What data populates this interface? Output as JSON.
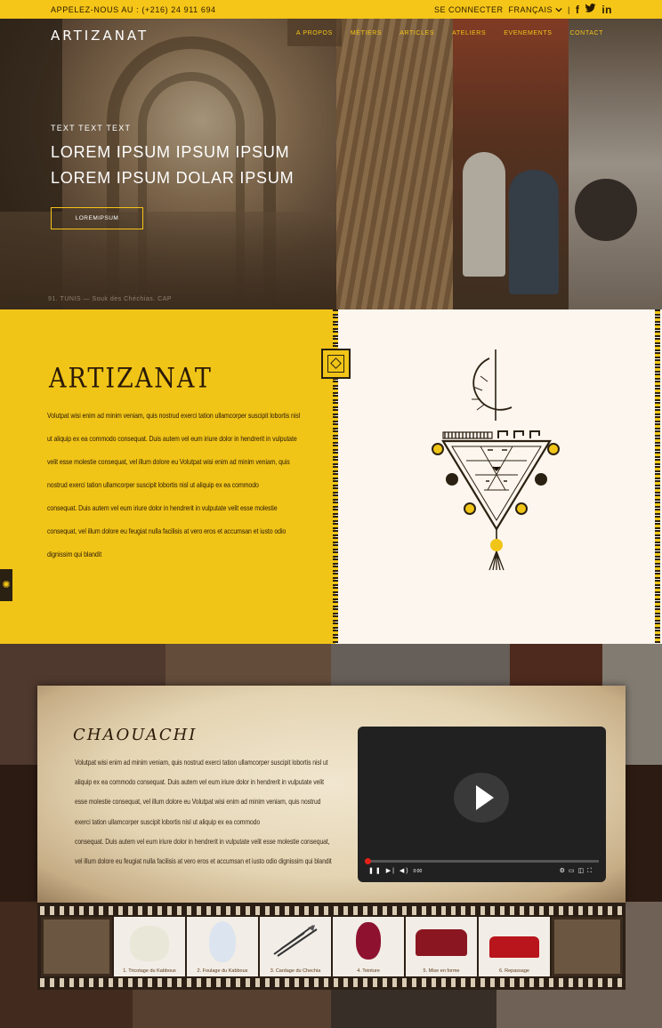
{
  "topbar": {
    "phone": "APPELEZ-NOUS AU : (+216) 24 911 694",
    "login": "SE CONNECTER",
    "language": "FRANÇAIS",
    "separator": "|",
    "social": [
      "facebook-icon",
      "twitter-icon",
      "linkedin-icon"
    ],
    "social_glyphs": {
      "facebook": "f",
      "twitter": "🐦",
      "linkedin": "in"
    }
  },
  "brand": {
    "logo_text": "ARTIZANAT"
  },
  "nav": {
    "items": [
      "A PROPOS",
      "MÉTIERS",
      "ARTICLES",
      "ATELIERS",
      "EVENEMENTS",
      "CONTACT"
    ],
    "active_index": 0
  },
  "hero": {
    "eyebrow": "TEXT TEXT TEXT",
    "headline_line1": "LOREM IPSUM IPSUM IPSUM",
    "headline_line2": "LOREM IPSUM DOLAR IPSUM",
    "button": "LOREMIPSUM",
    "photo_caption": "91. TUNIS — Souk des Chéchias. CAP"
  },
  "artizanat": {
    "title": "ARTIZANAT",
    "paragraph1": "Volutpat wisi enim ad minim veniam, quis nostrud exerci tation ullamcorper suscipit lobortis nisl ut aliquip ex ea commodo consequat. Duis autem vel eum iriure dolor in hendrerit in vulputate velit esse molestie consequat, vel illum dolore eu Volutpat wisi enim ad minim veniam, quis nostrud exerci tation ullamcorper suscipit lobortis nisl ut aliquip ex ea commodo",
    "paragraph2": "consequat. Duis autem vel eum iriure dolor in hendrerit in vulputate velit esse molestie consequat, vel illum dolore eu feugiat nulla facilisis at vero eros et accumsan et iusto odio dignissim qui blandit"
  },
  "chouachi": {
    "title": "CHAOUACHI",
    "paragraph1": "Volutpat wisi enim ad minim veniam, quis nostrud exerci tation ullamcorper suscipit lobortis nisl ut aliquip ex ea commodo consequat. Duis autem vel eum iriure dolor in hendrerit in vulputate velit esse molestie consequat, vel illum dolore eu Volutpat wisi enim ad minim veniam, quis nostrud exerci tation ullamcorper suscipit lobortis nisl ut aliquip ex ea commodo",
    "paragraph2": "consequat. Duis autem vel eum iriure dolor in hendrerit in vulputate velit esse molestie consequat, vel illum dolore eu feugiat nulla facilisis at vero eros et accumsan et iusto odio dignissim qui blandit",
    "video": {
      "time": "0:00"
    },
    "steps": [
      "1. Tricotage du Kabbous",
      "2. Foulage du Kabbous",
      "3. Cardage du Chechia",
      "4. Teinture",
      "5. Mise en forme",
      "6. Repassage"
    ]
  },
  "colors": {
    "accent": "#f5c518",
    "dark": "#2b1a08",
    "cream": "#fdf6ee"
  }
}
